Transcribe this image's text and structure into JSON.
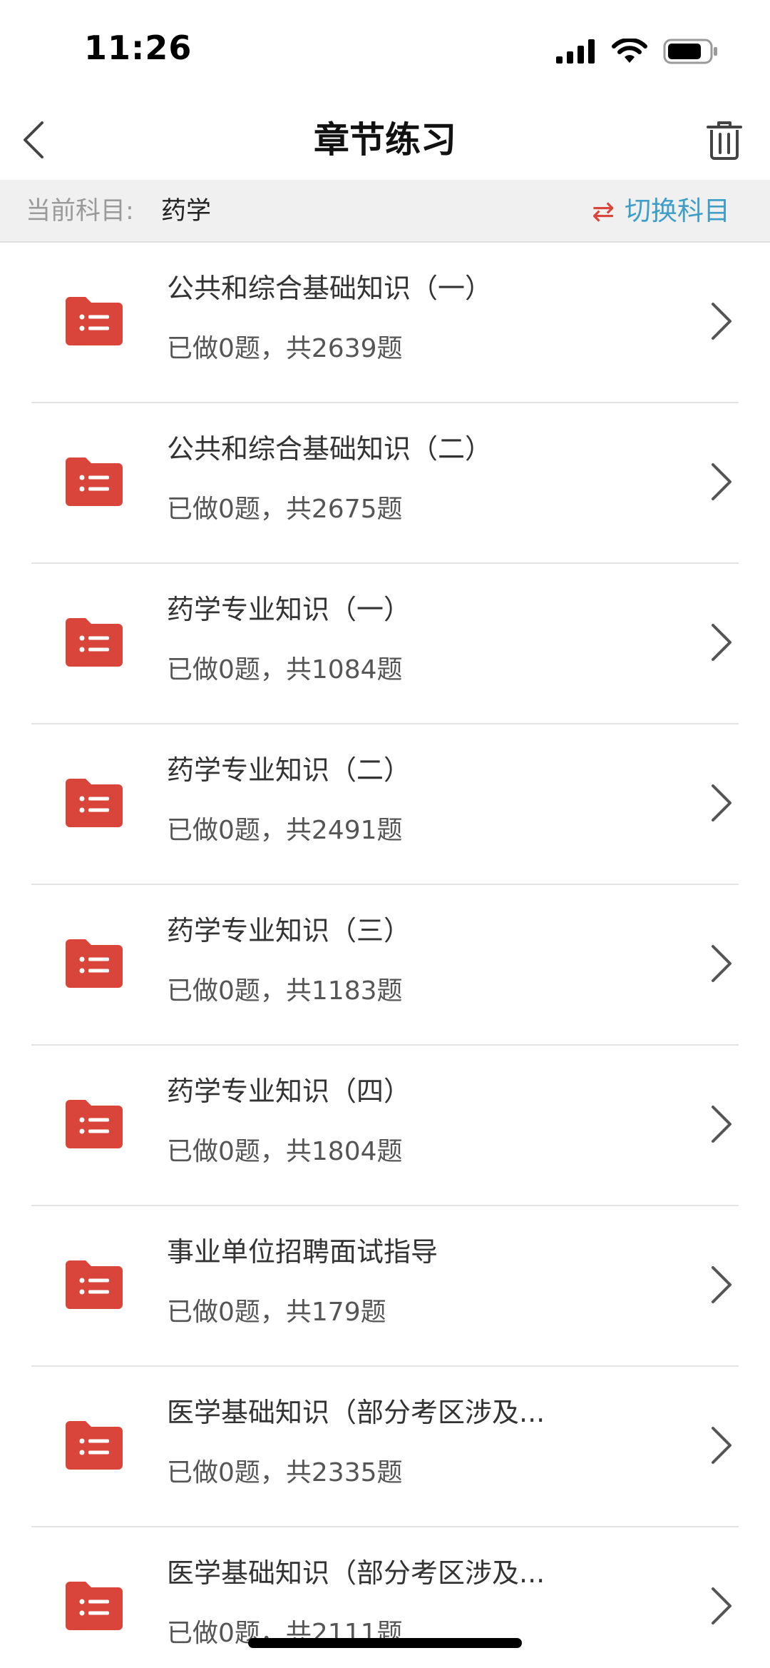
{
  "status_bar": {
    "time": "11:26"
  },
  "nav": {
    "title": "章节练习"
  },
  "subject_bar": {
    "label": "当前科目:",
    "value": "药学",
    "switch_icon": "⇄",
    "switch_label": "切换科目"
  },
  "colors": {
    "folder": "#d9453a",
    "switch_icon": "#d9453a",
    "switch_label": "#3f9ec8"
  },
  "chapters": [
    {
      "title": "公共和综合基础知识（一）",
      "progress": "已做0题，共2639题"
    },
    {
      "title": "公共和综合基础知识（二）",
      "progress": "已做0题，共2675题"
    },
    {
      "title": "药学专业知识（一）",
      "progress": "已做0题，共1084题"
    },
    {
      "title": "药学专业知识（二）",
      "progress": "已做0题，共2491题"
    },
    {
      "title": "药学专业知识（三）",
      "progress": "已做0题，共1183题"
    },
    {
      "title": "药学专业知识（四）",
      "progress": "已做0题，共1804题"
    },
    {
      "title": "事业单位招聘面试指导",
      "progress": "已做0题，共179题"
    },
    {
      "title": "医学基础知识（部分考区涉及...",
      "progress": "已做0题，共2335题"
    },
    {
      "title": "医学基础知识（部分考区涉及...",
      "progress": "已做0题，共2111题"
    }
  ]
}
